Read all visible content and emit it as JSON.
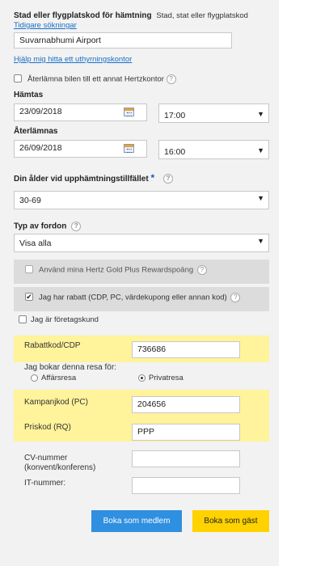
{
  "pickup": {
    "heading": "Stad eller flygplatskod för hämtning",
    "hint": "Stad, stat eller flygplatskod",
    "previous_searches_link": "Tidigare sökningar",
    "location_value": "Suvarnabhumi Airport",
    "help_find_link": "Hjälp mig hitta ett uthyrningskontor"
  },
  "return_other": {
    "label": "Återlämna bilen till ett annat Hertzkontor",
    "checked": false
  },
  "pickup_time": {
    "label": "Hämtas",
    "date": "23/09/2018",
    "time": "17:00"
  },
  "return_time": {
    "label": "Återlämnas",
    "date": "26/09/2018",
    "time": "16:00"
  },
  "age": {
    "label": "Din ålder vid upphämtningstillfället",
    "required_mark": "*",
    "value": "30-69"
  },
  "vehicle": {
    "label": "Typ av fordon",
    "value": "Visa alla"
  },
  "gold_plus": {
    "label": "Använd mina Hertz Gold Plus Rewardspoäng",
    "checked": false
  },
  "discount": {
    "label": "Jag har rabatt (CDP, PC, värdekupong eller annan kod)",
    "checked": true
  },
  "business_customer": {
    "label": "Jag är företagskund",
    "checked": false
  },
  "codes": {
    "rabatt_label": "Rabattkod/CDP",
    "rabatt_value": "736686",
    "trip_question": "Jag bokar denna resa för:",
    "option_business": "Affärsresa",
    "option_private": "Privatresa",
    "selected_option": "Privatresa",
    "campaign_label": "Kampanjkod (PC)",
    "campaign_value": "204656",
    "price_label": "Priskod (RQ)",
    "price_value": "PPP",
    "cv_label_line1": "CV-nummer",
    "cv_label_line2": "(konvent/konferens)",
    "cv_value": "",
    "it_label": "IT-nummer:",
    "it_value": ""
  },
  "buttons": {
    "member": "Boka som medlem",
    "guest": "Boka som gäst"
  },
  "icons": {
    "help": "?",
    "check": "✔",
    "caret": "▼"
  },
  "colors": {
    "highlight": "#fff39b",
    "member_button": "#2f8fe0",
    "guest_button": "#ffd200",
    "link": "#1a6fc4"
  }
}
